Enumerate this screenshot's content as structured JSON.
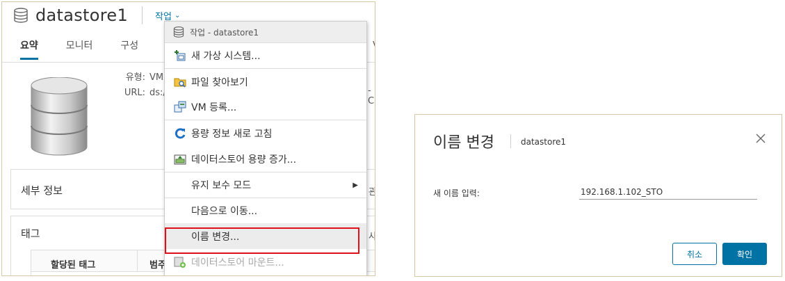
{
  "left_panel": {
    "title": "datastore1",
    "actions_label": "작업",
    "tabs": [
      {
        "label": "요약",
        "active": true
      },
      {
        "label": "모니터",
        "active": false
      },
      {
        "label": "구성",
        "active": false
      }
    ],
    "info": {
      "type_key": "유형:",
      "type_val": "VM",
      "url_key": "URL:",
      "url_val": "ds:/"
    },
    "edge_chars": {
      "url_tail": "-C",
      "v": "V",
      "details_tail": "관",
      "tags_tail": "사"
    },
    "details_title": "세부 정보",
    "tags_title": "태그",
    "tags_table": {
      "col1": "할당된 태그",
      "col2": "범주"
    }
  },
  "menu": {
    "header": "작업 - datastore1",
    "items": [
      {
        "label": "새 가상 시스템...",
        "icon": "new-vm-icon"
      },
      {
        "label": "파일 찾아보기",
        "icon": "browse-files-icon"
      },
      {
        "label": "VM 등록...",
        "icon": "register-vm-icon"
      },
      {
        "label": "용량 정보 새로 고침",
        "icon": "refresh-icon"
      },
      {
        "label": "데이터스토어 용량 증가...",
        "icon": "increase-capacity-icon"
      },
      {
        "label": "유지 보수 모드",
        "icon": ""
      },
      {
        "label": "다음으로 이동...",
        "icon": ""
      },
      {
        "label": "이름 변경...",
        "icon": ""
      },
      {
        "label": "데이터스토어 마운트...",
        "icon": "mount-icon"
      }
    ]
  },
  "dialog": {
    "title": "이름 변경",
    "subtitle": "datastore1",
    "field_label": "새 이름 입력:",
    "field_value": "192.168.1.102_STO",
    "cancel_label": "취소",
    "ok_label": "확인"
  },
  "colors": {
    "accent": "#0072a3",
    "highlight_border": "#e0101b"
  }
}
